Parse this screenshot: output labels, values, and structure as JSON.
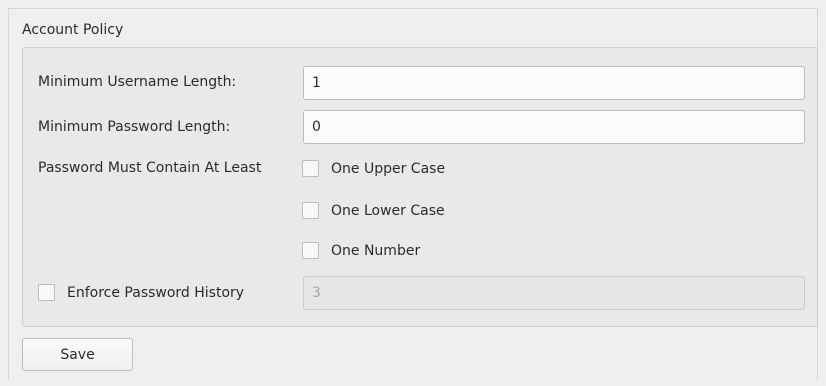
{
  "account_policy": {
    "title": "Account Policy",
    "min_username": {
      "label": "Minimum Username Length:",
      "value": "1"
    },
    "min_password": {
      "label": "Minimum Password Length:",
      "value": "0"
    },
    "must_contain": {
      "label": "Password Must Contain At Least",
      "options": [
        {
          "label": "One Upper Case",
          "checked": false
        },
        {
          "label": "One Lower Case",
          "checked": false
        },
        {
          "label": "One Number",
          "checked": false
        }
      ]
    },
    "password_history": {
      "label": "Enforce Password History",
      "checked": false,
      "value": "3",
      "enabled": false
    }
  },
  "actions": {
    "save_label": "Save"
  }
}
